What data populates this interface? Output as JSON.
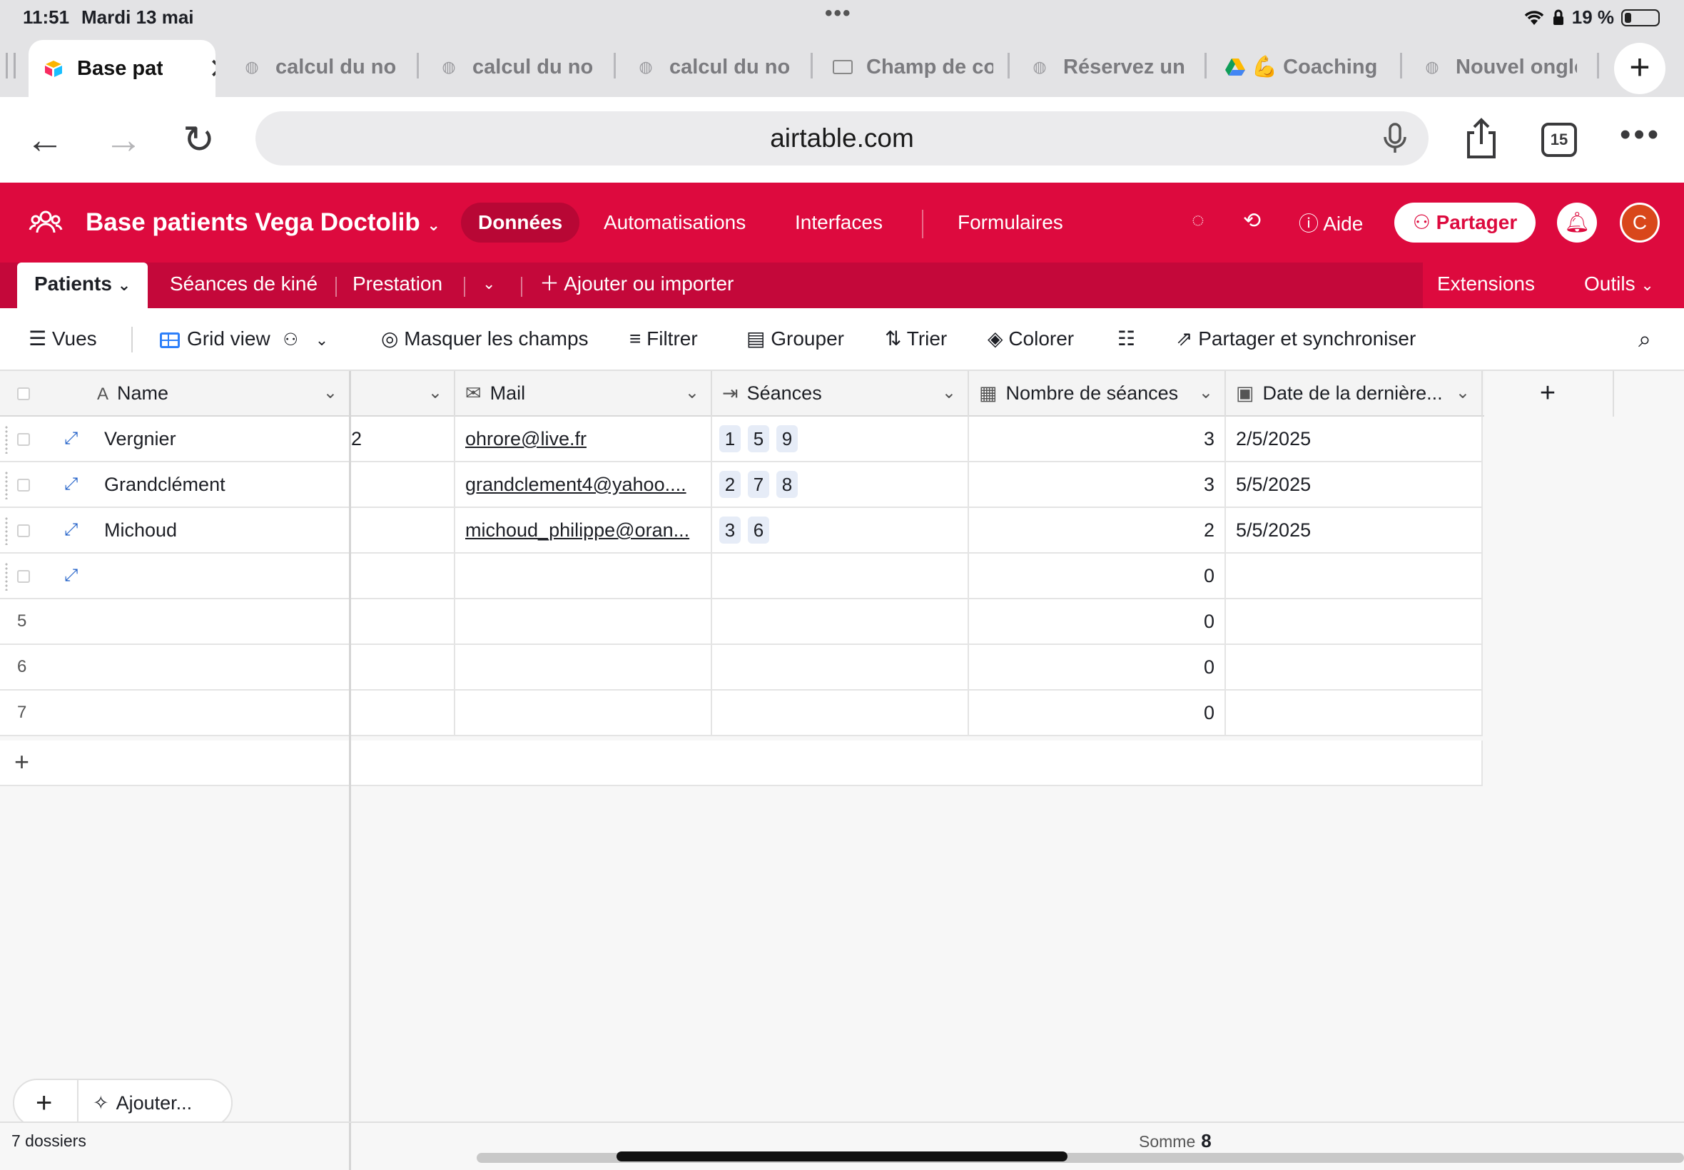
{
  "status_bar": {
    "time": "11:51",
    "date": "Mardi 13 mai",
    "battery": "19 %",
    "battery_level": 0.19
  },
  "browser": {
    "tabs": [
      {
        "label": "Base pat",
        "active": true
      },
      {
        "label": "calcul du no"
      },
      {
        "label": "calcul du no"
      },
      {
        "label": "calcul du no"
      },
      {
        "label": "Champ de co"
      },
      {
        "label": "Réservez un"
      },
      {
        "label": "💪 Coaching"
      },
      {
        "label": "Nouvel ongle"
      }
    ],
    "url": "airtable.com",
    "tab_count": "15"
  },
  "header": {
    "base_title": "Base patients Vega Doctolib",
    "nav": [
      "Données",
      "Automatisations",
      "Interfaces",
      "Formulaires"
    ],
    "help": "Aide",
    "share": "Partager",
    "avatar_initial": "C"
  },
  "tables": {
    "active": "Patients",
    "others": [
      "Séances de kiné",
      "Prestation"
    ],
    "add": "Ajouter ou importer",
    "extensions": "Extensions",
    "tools": "Outils"
  },
  "toolbar": {
    "views": "Vues",
    "grid_view": "Grid view",
    "hide_fields": "Masquer les champs",
    "filter": "Filtrer",
    "group": "Grouper",
    "sort": "Trier",
    "color": "Colorer",
    "share_sync": "Partager et synchroniser"
  },
  "grid": {
    "columns": {
      "name": "Name",
      "mail": "Mail",
      "seances": "Séances",
      "nombre": "Nombre de séances",
      "date": "Date de la dernière..."
    },
    "rows": [
      {
        "name": "Vergnier",
        "partial": "2",
        "mail": "ohrore@live.fr",
        "seances": [
          "1",
          "5",
          "9"
        ],
        "nombre": "3",
        "date": "2/5/2025"
      },
      {
        "name": "Grandclément",
        "partial": "",
        "mail": "grandclement4@yahoo....",
        "seances": [
          "2",
          "7",
          "8"
        ],
        "nombre": "3",
        "date": "5/5/2025"
      },
      {
        "name": "Michoud",
        "partial": "",
        "mail": "michoud_philippe@oran...",
        "seances": [
          "3",
          "6"
        ],
        "nombre": "2",
        "date": "5/5/2025"
      },
      {
        "name": "",
        "partial": "",
        "mail": "",
        "seances": [],
        "nombre": "0",
        "date": ""
      },
      {
        "rownum": "5",
        "name": "",
        "partial": "",
        "mail": "",
        "seances": [],
        "nombre": "0",
        "date": ""
      },
      {
        "rownum": "6",
        "name": "",
        "partial": "",
        "mail": "",
        "seances": [],
        "nombre": "0",
        "date": ""
      },
      {
        "rownum": "7",
        "name": "",
        "partial": "",
        "mail": "",
        "seances": [],
        "nombre": "0",
        "date": ""
      }
    ]
  },
  "footer": {
    "add_label": "Ajouter...",
    "record_count": "7 dossiers",
    "sum_label": "Somme",
    "sum_value": "8"
  }
}
